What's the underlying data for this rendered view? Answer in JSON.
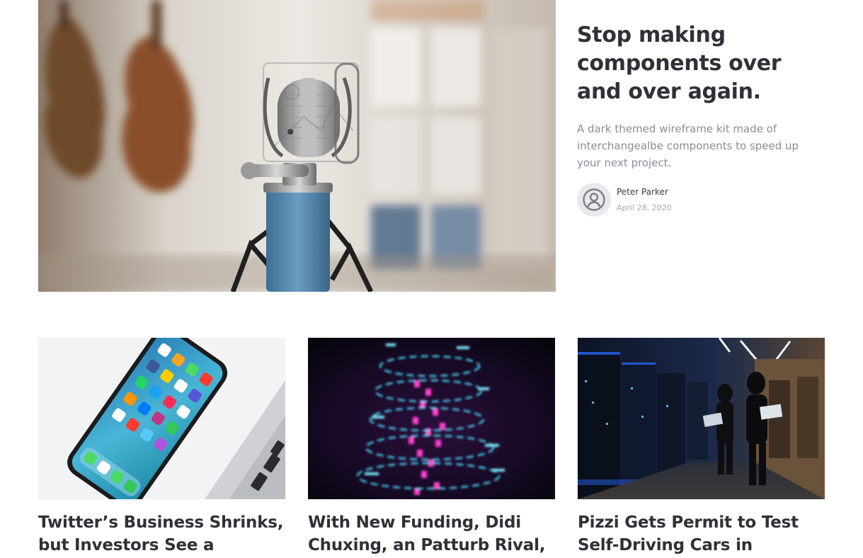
{
  "hero": {
    "title": "Stop making components over and over again.",
    "description": "A dark themed wireframe kit made of interchangealbe components to speed up your next project.",
    "author": {
      "name": "Peter Parker",
      "date": "April 28, 2020",
      "avatar_icon": "user-circle-icon"
    },
    "image_subject": "microphone"
  },
  "cards": [
    {
      "title": "Twitter’s Business Shrinks, but Investors See a Glimmer",
      "image_subject": "smartphone"
    },
    {
      "title": "With New Funding, Didi Chuxing, an Patturb Rival,",
      "image_subject": "neon-spiral"
    },
    {
      "title": "Pizzi Gets Permit to Test Self-Driving Cars in",
      "image_subject": "server-room"
    }
  ],
  "colors": {
    "title_text": "#2f3138",
    "muted_text": "#8a8d96",
    "date_text": "#a4a7ae",
    "avatar_bg": "#e8e9ec"
  }
}
